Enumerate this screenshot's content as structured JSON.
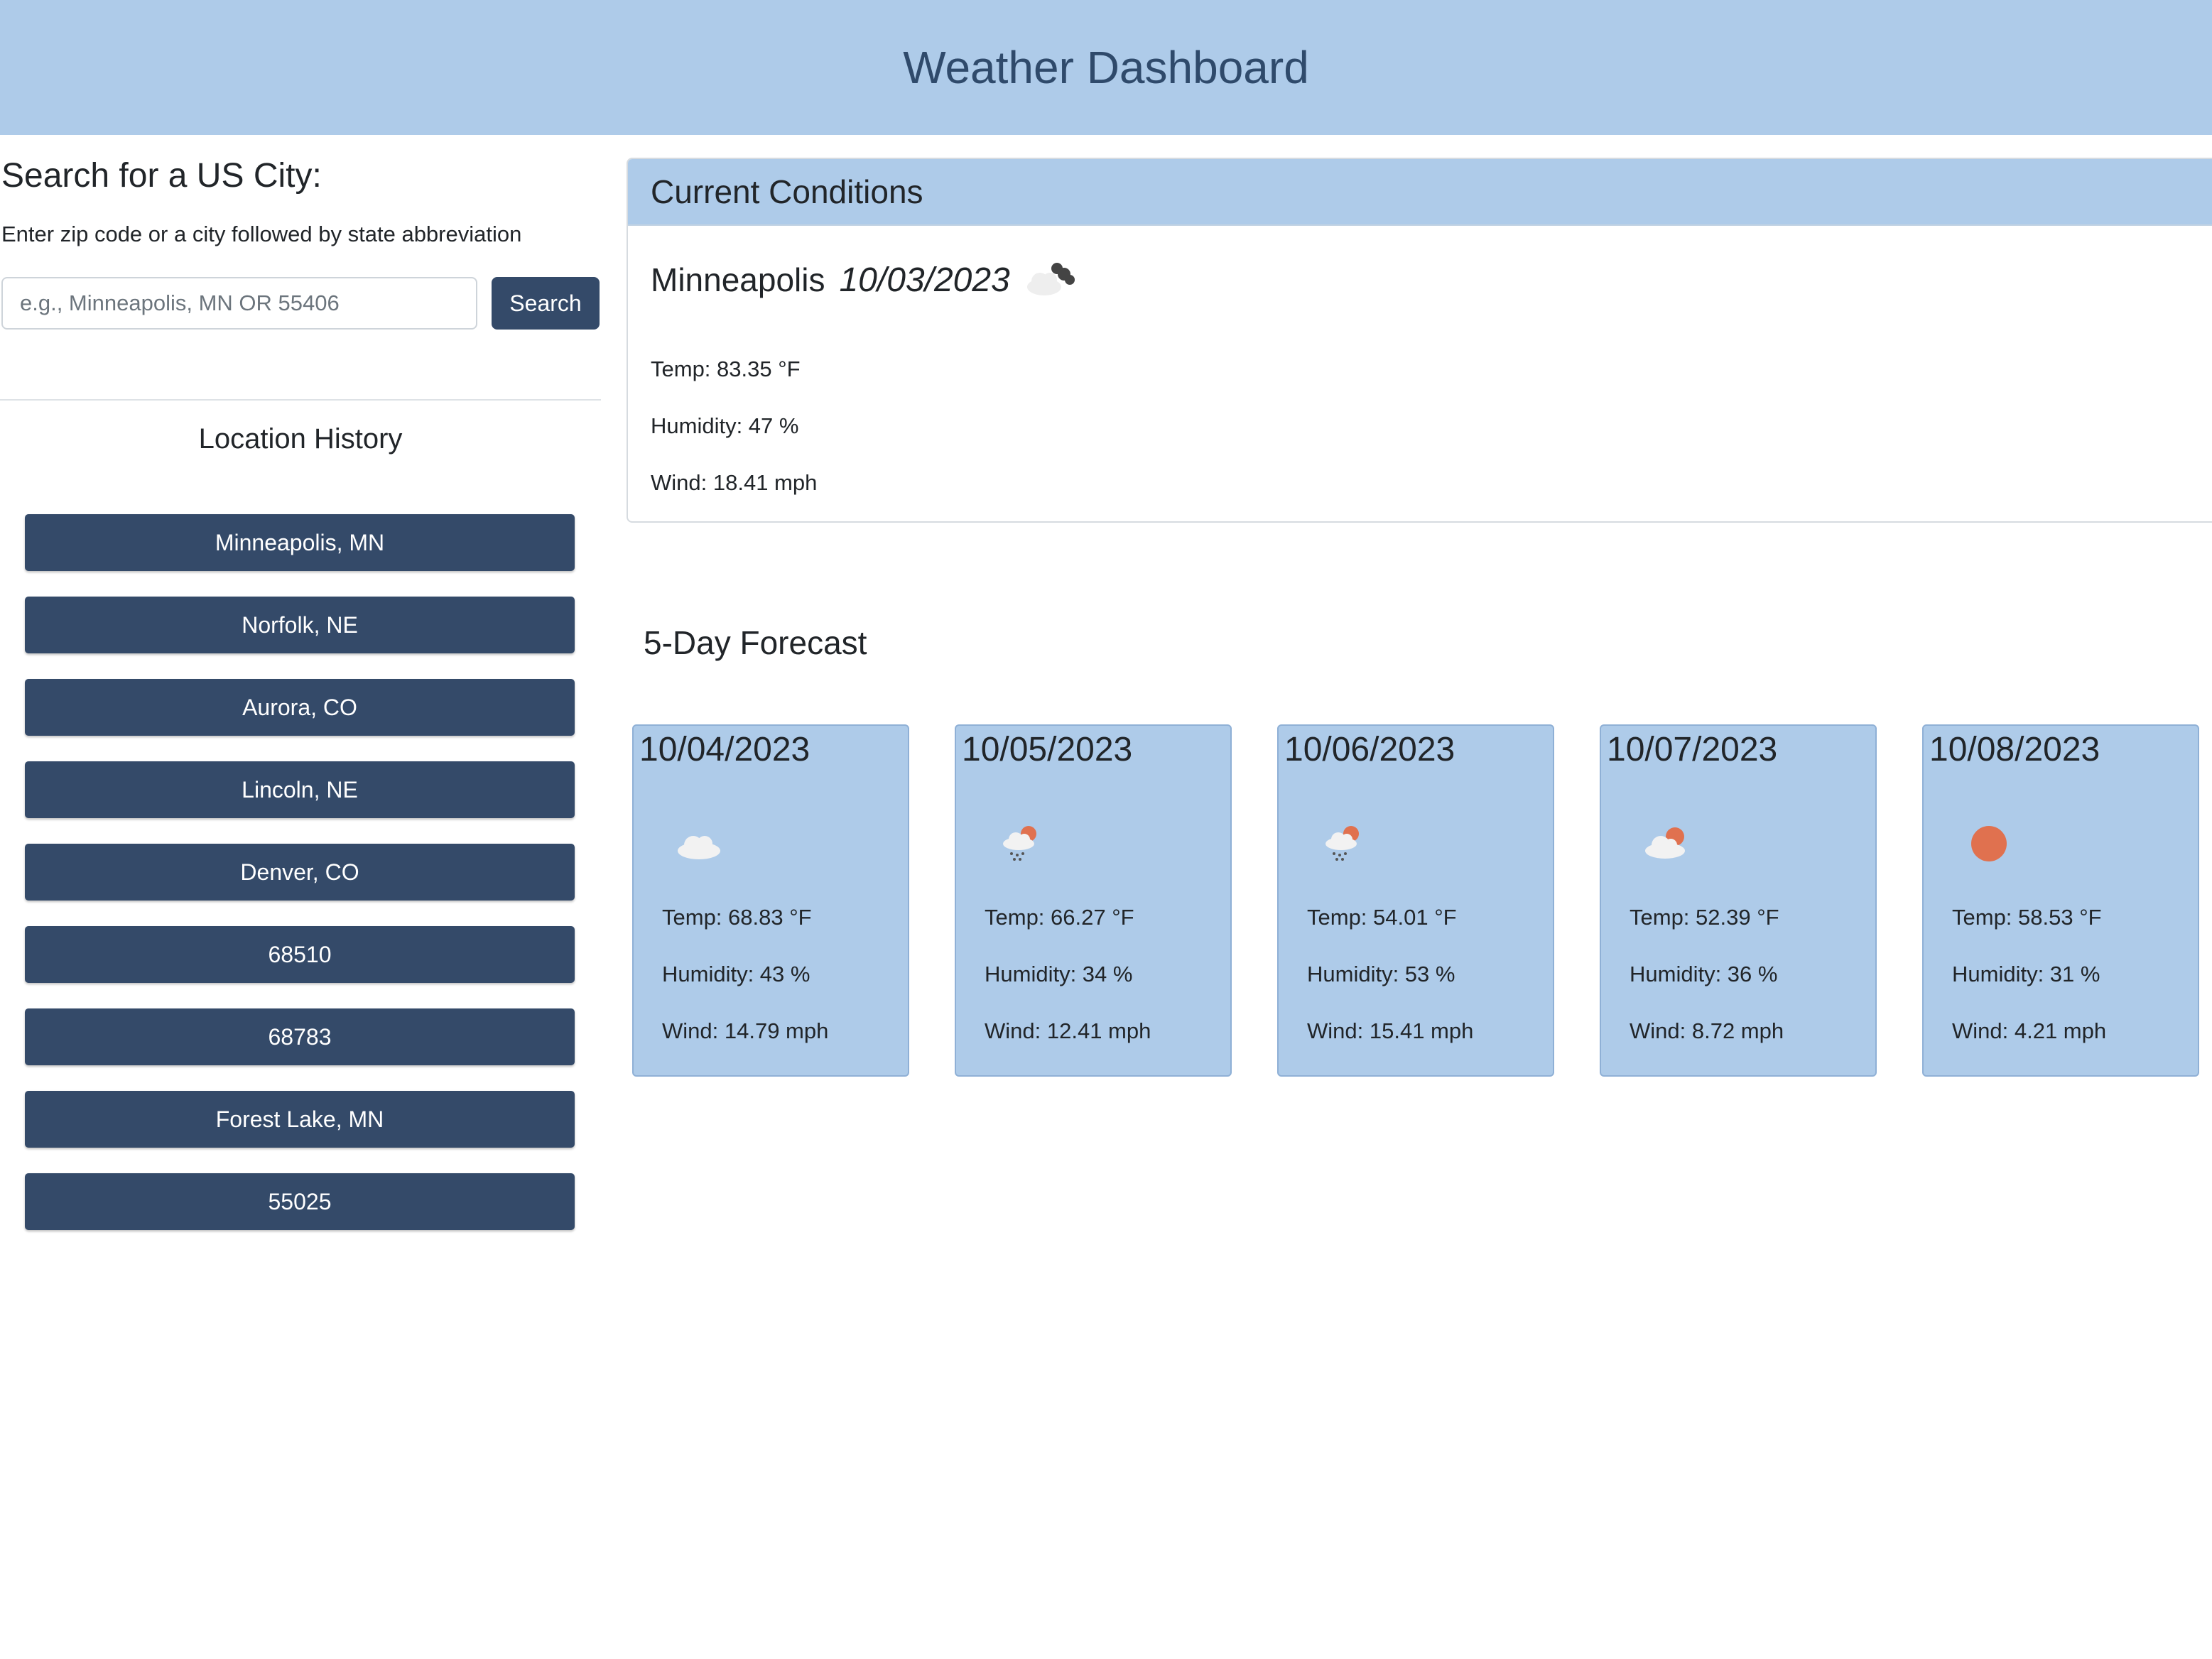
{
  "header": {
    "title": "Weather Dashboard"
  },
  "search": {
    "title": "Search for a US City:",
    "hint": "Enter zip code or a city followed by state abbreviation",
    "placeholder": "e.g., Minneapolis, MN OR 55406",
    "value": "",
    "button_label": "Search"
  },
  "history": {
    "title": "Location History",
    "items": [
      "Minneapolis, MN",
      "Norfolk, NE",
      "Aurora, CO",
      "Lincoln, NE",
      "Denver, CO",
      "68510",
      "68783",
      "Forest Lake, MN",
      "55025"
    ]
  },
  "current": {
    "heading": "Current Conditions",
    "city": "Minneapolis",
    "date": "10/03/2023",
    "icon": "broken-clouds-icon",
    "temp": "Temp: 83.35 °F",
    "humidity": "Humidity: 47 %",
    "wind": "Wind: 18.41 mph"
  },
  "forecast": {
    "title": "5-Day Forecast",
    "days": [
      {
        "date": "10/04/2023",
        "icon": "cloud-icon",
        "temp": "Temp: 68.83 °F",
        "humidity": "Humidity: 43 %",
        "wind": "Wind: 14.79 mph"
      },
      {
        "date": "10/05/2023",
        "icon": "rain-sun-icon",
        "temp": "Temp: 66.27 °F",
        "humidity": "Humidity: 34 %",
        "wind": "Wind: 12.41 mph"
      },
      {
        "date": "10/06/2023",
        "icon": "rain-sun-icon",
        "temp": "Temp: 54.01 °F",
        "humidity": "Humidity: 53 %",
        "wind": "Wind: 15.41 mph"
      },
      {
        "date": "10/07/2023",
        "icon": "cloud-sun-icon",
        "temp": "Temp: 52.39 °F",
        "humidity": "Humidity: 36 %",
        "wind": "Wind: 8.72 mph"
      },
      {
        "date": "10/08/2023",
        "icon": "sun-icon",
        "temp": "Temp: 58.53 °F",
        "humidity": "Humidity: 31 %",
        "wind": "Wind: 4.21 mph"
      }
    ]
  },
  "colors": {
    "header_bg": "#aecbe9",
    "header_text": "#2f4a6b",
    "button_bg": "#344a69",
    "sun": "#e0714f"
  }
}
